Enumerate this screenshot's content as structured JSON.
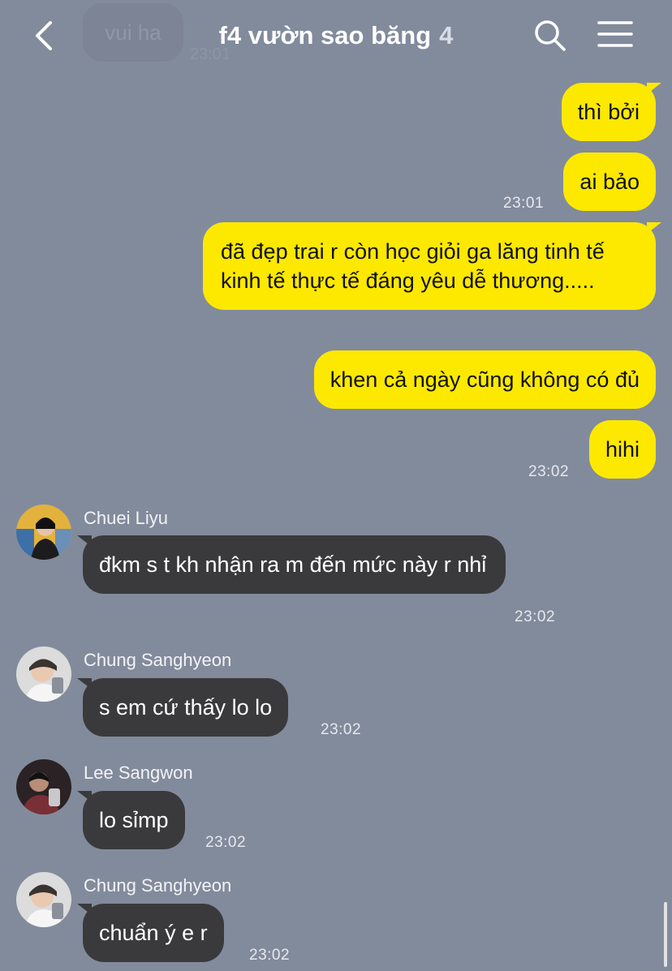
{
  "header": {
    "title": "f4 vườn sao băng",
    "member_count": "4",
    "back_icon": "chevron-left-icon",
    "search_icon": "search-icon",
    "menu_icon": "hamburger-menu-icon"
  },
  "previous_message": {
    "text": "vui ha",
    "time": "23:01"
  },
  "outgoing": [
    {
      "text": "thì bởi",
      "time": ""
    },
    {
      "text": "ai bảo",
      "time": "23:01"
    },
    {
      "text": "đã đẹp trai r còn học giỏi ga lăng tinh tế kinh tế thực tế đáng yêu dễ thương.....",
      "time": ""
    },
    {
      "text": "khen cả ngày cũng không có đủ",
      "time": ""
    },
    {
      "text": "hihi",
      "time": "23:02"
    }
  ],
  "incoming": [
    {
      "sender": "Chuei Liyu",
      "text": "đkm s t kh nhận ra m đến mức này r nhỉ",
      "time": "23:02"
    },
    {
      "sender": "Chung Sanghyeon",
      "text": "s em cứ thấy lo lo",
      "time": "23:02"
    },
    {
      "sender": "Lee Sangwon",
      "text": "lo sỉmp",
      "time": "23:02"
    },
    {
      "sender": "Chung Sanghyeon",
      "text": "chuẩn ý e r",
      "time": "23:02"
    }
  ],
  "colors": {
    "background": "#828b9c",
    "outgoing_bubble": "#fde800",
    "incoming_bubble": "#3a3a3c"
  }
}
